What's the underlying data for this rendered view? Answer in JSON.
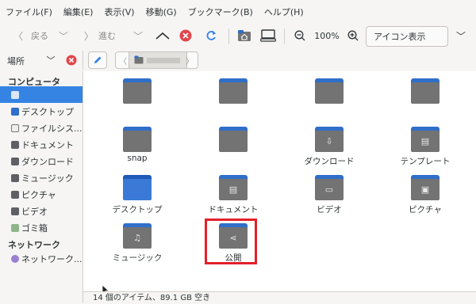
{
  "menu": [
    "ファイル(F)",
    "編集(E)",
    "表示(V)",
    "移動(G)",
    "ブックマーク(B)",
    "ヘルプ(H)"
  ],
  "toolbar": {
    "back_label": "戻る",
    "forward_label": "進む",
    "zoom_level": "100%",
    "view_mode": "アイコン表示"
  },
  "sidebar": {
    "header_label": "場所",
    "computer_section": "コンピュータ",
    "items": [
      {
        "label": "",
        "icon": "home-icon",
        "selected": true
      },
      {
        "label": "デスクトップ",
        "icon": "desktop-icon"
      },
      {
        "label": "ファイルシス...",
        "icon": "drive-icon"
      },
      {
        "label": "ドキュメント",
        "icon": "documents-icon"
      },
      {
        "label": "ダウンロード",
        "icon": "downloads-icon"
      },
      {
        "label": "ミュージック",
        "icon": "music-icon"
      },
      {
        "label": "ピクチャ",
        "icon": "pictures-icon"
      },
      {
        "label": "ビデオ",
        "icon": "videos-icon"
      },
      {
        "label": "ゴミ箱",
        "icon": "trash-icon"
      }
    ],
    "network_section": "ネットワーク",
    "network_items": [
      {
        "label": "ネットワーク...",
        "icon": "network-icon"
      }
    ]
  },
  "files": [
    {
      "label": "",
      "glyph": ""
    },
    {
      "label": "",
      "glyph": ""
    },
    {
      "label": "",
      "glyph": ""
    },
    {
      "label": "",
      "glyph": ""
    },
    {
      "label": "snap",
      "glyph": ""
    },
    {
      "label": "",
      "glyph": ""
    },
    {
      "label": "ダウンロード",
      "glyph": "⇩"
    },
    {
      "label": "テンプレート",
      "glyph": "▤"
    },
    {
      "label": "デスクトップ",
      "glyph": ""
    },
    {
      "label": "ドキュメント",
      "glyph": "▤"
    },
    {
      "label": "ビデオ",
      "glyph": "▭"
    },
    {
      "label": "ピクチャ",
      "glyph": "▣"
    },
    {
      "label": "ミュージック",
      "glyph": "♫"
    },
    {
      "label": "公開",
      "glyph": "⋖"
    }
  ],
  "status": "14 個のアイテム、89.1 GB 空き",
  "colors": {
    "accent": "#3584e4",
    "folder_tab": "#2f6fc9",
    "folder_body": "#737373",
    "highlight": "#e3202a"
  }
}
